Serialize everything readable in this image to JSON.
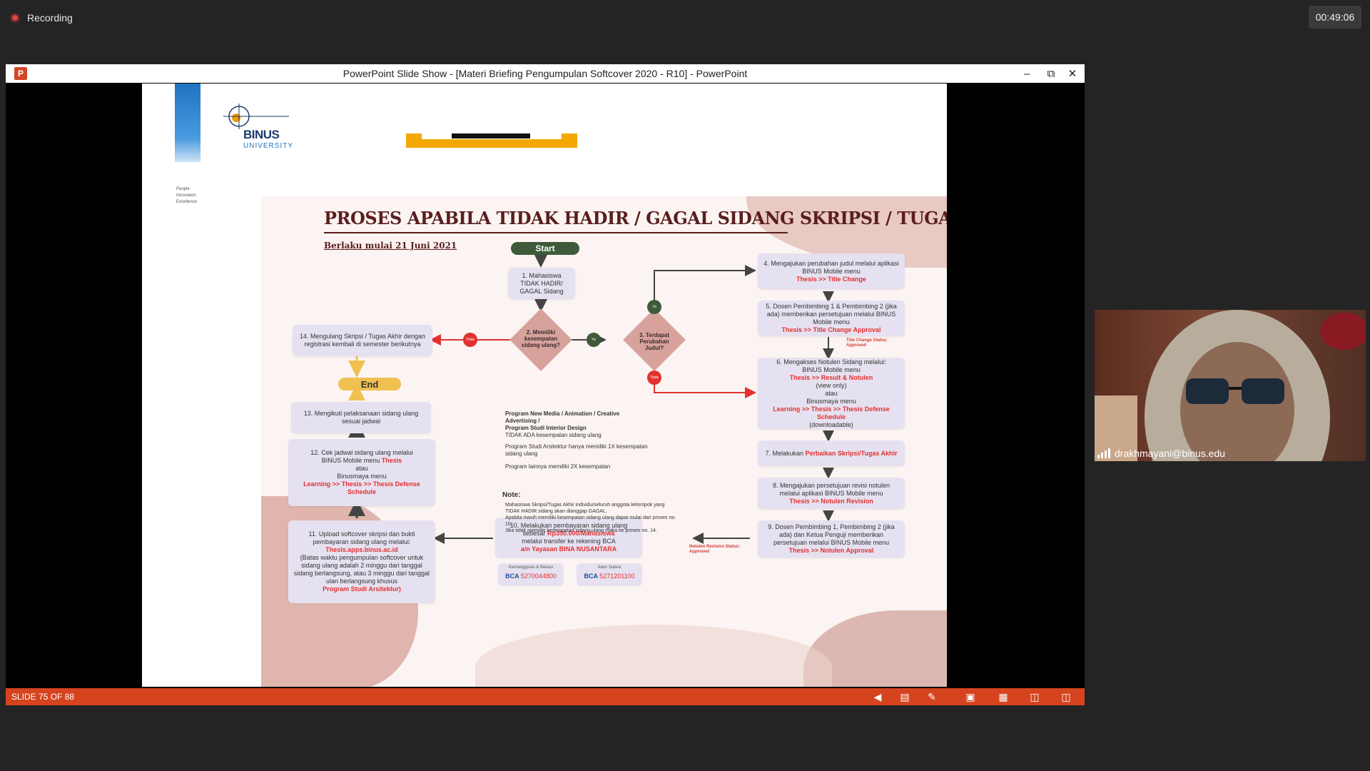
{
  "recording": {
    "label": "Recording"
  },
  "timer": {
    "value": "00:49:06"
  },
  "window": {
    "title": "PowerPoint Slide Show - [Materi Briefing Pengumpulan Softcover 2020 - R10] - PowerPoint",
    "app_icon": "powerpoint-icon",
    "controls": [
      "minimize-icon",
      "restore-icon",
      "close-icon"
    ]
  },
  "slide": {
    "logo_text": "BINUS",
    "logo_sub": "UNIVERSITY",
    "tagline": [
      "People",
      "Innovation",
      "Excellence"
    ],
    "flow": {
      "title": "PROSES APABILA TIDAK HADIR / GAGAL SIDANG SKRIPSI / TUGAS AKHIR",
      "subtitle": "Berlaku mulai 21 Juni 2021",
      "start": "Start",
      "end": "End",
      "step1": "1. Mahasiswa TIDAK HADIR/ GAGAL Sidang",
      "step2": "2. Memiliki kesempatan sidang ulang?",
      "step3": "3. Terdapat Perubahan Judul?",
      "step4_a": "4. Mengajukan perubahan judul melalui aplikasi BINUS Mobile menu",
      "step4_b": "Thesis >> Title Change",
      "step5_a": "5. Dosen Pembimbing 1 & Pembimbing 2 (jika ada) memberikan persetujuan melalui BINUS Mobile menu",
      "step5_b": "Thesis >> Title Change Approval",
      "title_change_status": "Title Change Status: Approved",
      "step6_a": "6. Mengakses Notulen Sidang melalui:",
      "step6_b": "BINUS Mobile menu",
      "step6_c": "Thesis >> Result & Notulen",
      "step6_d": "(view only)",
      "step6_e": "atau",
      "step6_f": "Binusmaya menu",
      "step6_g": "Learning >> Thesis >> Thesis Defense Schedule",
      "step6_h": "(downloadable)",
      "step7_a": "7. Melakukan",
      "step7_b": "Perbaikan Skripsi/Tugas Akhir",
      "step8_a": "8. Mengajukan persetujuan revisi notulen melalui aplikasi BINUS Mobile menu",
      "step8_b": "Thesis >> Notulen Revision",
      "step9_a": "9. Dosen Pembimbing 1, Pembimbing 2 (jika ada) dan Ketua Penguji memberikan persetujuan melalui BINUS Mobile menu",
      "step9_b": "Thesis >> Notulen Approval",
      "notulen_status": "Notulen Revision Status: Approved",
      "step10_a": "10. Melakukan pembayaran sidang ulang sebesar",
      "step10_b": "Rp350.000/Mahasiswa",
      "step10_c": "melalui transfer ke rekening BCA",
      "step10_d": "a/n Yayasan BINA NUSANTARA",
      "step11_a": "11. Upload softcover skripsi dan bukti pembayaran sidang ulang melalui:",
      "step11_b": "Thesis.apps.binus.ac.id",
      "step11_c": "(Batas waktu pengumpulan softcover untuk sidang ulang adalah 2 minggu dari tanggal sidang berlangsung, atau 3 minggu dari tanggal ulan berlangsung khusus",
      "step11_d": "Program Studi Arsitektur)",
      "step12_a": "12. Cek jadwal sidang ulang melalui",
      "step12_b": "BINUS Mobile menu",
      "step12_c": "Thesis",
      "step12_d": "atau",
      "step12_e": "Binusmaya menu",
      "step12_f": "Learning >> Thesis >> Thesis Defense Schedule",
      "step13": "13. Mengikuti pelaksanaan sidang ulang sesuai jadwal",
      "step14": "14. Mengulang Skripsi / Tugas Akhir dengan registrasi kembali di semester berikutnya",
      "yes": "Ya",
      "no": "Tidak",
      "program_note1_a": "Program New Media / Animation / Creative Advertising /",
      "program_note1_b": "Program Studi Interior Design",
      "program_note1_c": "TIDAK ADA kesempatan sidang ulang",
      "program_note2": "Program Studi Arsitektur hanya memiliki 1X kesempatan sidang ulang",
      "program_note3": "Program lainnya memiliki 2X kesempatan",
      "note_label": "Note:",
      "note_1": "Mahasiswa Skripsi/Tugas Akhir individu/seluruh anggota kelompok yang TIDAK HADIR sidang akan dianggap GAGAL.",
      "note_2": "Apabila masih memiliki kesempatan sidang ulang dapat mulai dari proses no. 10.",
      "note_3": "Jika tidak memiliki kesempatan sidang ulang maka ke proses no. 14.",
      "bca1_label": "Kemanggisan & Bekasi",
      "bca1_brand": "BCA",
      "bca1_num": "5270044800",
      "bca2_label": "Alam Sutera",
      "bca2_brand": "BCA",
      "bca2_num": "5271201100"
    }
  },
  "statusbar": {
    "slide_counter": "SLIDE 75 OF 88",
    "icons": [
      "previous-icon",
      "notes-icon",
      "pointer-pen-icon",
      "normal-view-icon",
      "slide-sorter-icon",
      "reading-view-icon",
      "slideshow-icon"
    ]
  },
  "webcam": {
    "name": "drakhmayani@binus.edu",
    "signal_icon": "signal-icon"
  },
  "colors": {
    "accent": "#d5441f",
    "flow_red": "#e23030",
    "flow_dark": "#5a1e1e",
    "box_fill": "#e6e1f0"
  }
}
